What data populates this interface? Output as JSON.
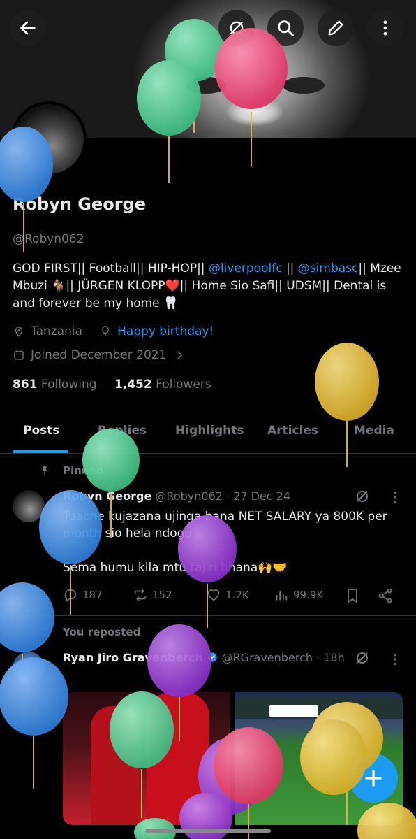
{
  "profile": {
    "name": "Robyn George",
    "handle": "@Robyn062",
    "bio_parts": {
      "p1": "GOD FIRST|| Football|| HIP-HOP|| ",
      "link1": "@liverpoolfc",
      "p2": " || ",
      "link2": "@simbasc",
      "p3": "|| Mzee Mbuzi 🐐|| JÜRGEN KLOPP❤️|| Home Sio Safi|| UDSM|| Dental is and forever be my home 🦷"
    },
    "location": "Tanzania",
    "birthday": "Happy birthday!",
    "joined": "Joined December 2021",
    "following_count": "861",
    "following_label": "Following",
    "followers_count": "1,452",
    "followers_label": "Followers"
  },
  "tabs": [
    "Posts",
    "Replies",
    "Highlights",
    "Articles",
    "Media"
  ],
  "pinned_post": {
    "pinned_label": "Pinned",
    "author": "Robyn George",
    "handle": "@Robyn062",
    "date": "· 27 Dec 24",
    "text_line1": "Tuache kujazana ujinga bana NET SALARY ya 800K per month sio hela ndogo",
    "text_line2": "Sema humu kila mtu tajiri bhana🙌🤝",
    "replies": "187",
    "reposts": "152",
    "likes": "1.2K",
    "views": "99.9K"
  },
  "repost": {
    "label": "You reposted",
    "author": "Ryan Jiro Gravenberch",
    "handle": "@RGravenberch",
    "time": "· 18h"
  },
  "colors": {
    "accent": "#1d9bf0",
    "balloon_green": "#4fd39a",
    "balloon_pink": "#ec4a78",
    "balloon_blue": "#3d8fe6",
    "balloon_yellow": "#e9c33c",
    "balloon_purple": "#9b3fd6"
  }
}
